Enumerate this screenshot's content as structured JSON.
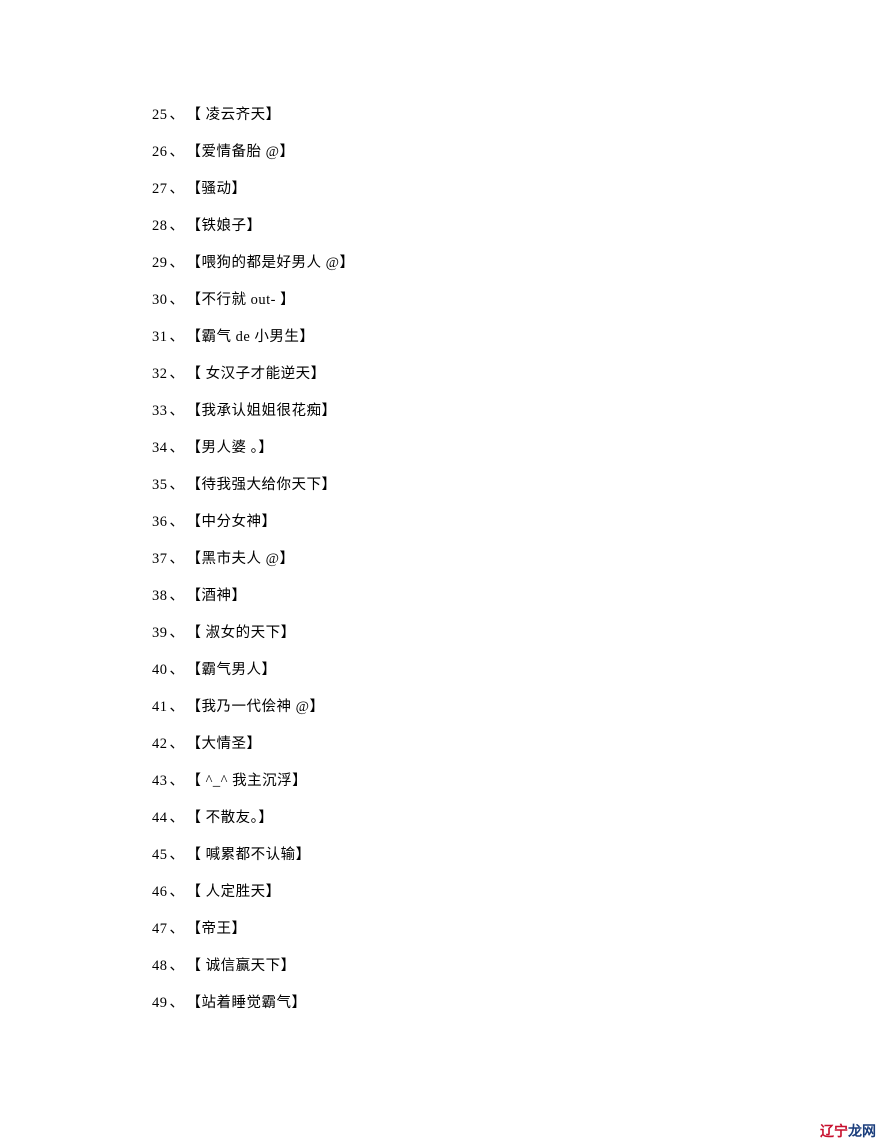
{
  "items": [
    {
      "num": "25",
      "text": "【  凌云齐天】"
    },
    {
      "num": "26",
      "text": "【爱情备胎  @】"
    },
    {
      "num": "27",
      "text": "【骚动】"
    },
    {
      "num": "28",
      "text": "【铁娘子】"
    },
    {
      "num": "29",
      "text": "【喂狗的都是好男人  @】"
    },
    {
      "num": "30",
      "text": "【不行就  out- 】"
    },
    {
      "num": "31",
      "text": "【霸气  de 小男生】"
    },
    {
      "num": "32",
      "text": "【   女汉子才能逆天】"
    },
    {
      "num": "33",
      "text": "【我承认姐姐很花痴】"
    },
    {
      "num": "34",
      "text": "【男人婆    。】"
    },
    {
      "num": "35",
      "text": "【待我强大给你天下】"
    },
    {
      "num": "36",
      "text": "【中分女神】"
    },
    {
      "num": "37",
      "text": "【黑市夫人  @】"
    },
    {
      "num": "38",
      "text": "【酒神】"
    },
    {
      "num": "39",
      "text": "【   淑女的天下】"
    },
    {
      "num": "40",
      "text": "【霸气男人】"
    },
    {
      "num": "41",
      "text": "【我乃一代侩神  @】"
    },
    {
      "num": "42",
      "text": "【大情圣】"
    },
    {
      "num": "43",
      "text": "【 ^_^  我主沉浮】"
    },
    {
      "num": "44",
      "text": "【   不散友。】"
    },
    {
      "num": "45",
      "text": "【   喊累都不认输】"
    },
    {
      "num": "46",
      "text": "【   人定胜天】"
    },
    {
      "num": "47",
      "text": "【帝王】"
    },
    {
      "num": "48",
      "text": "【   诚信赢天下】"
    },
    {
      "num": "49",
      "text": "【站着睡觉霸气】"
    }
  ],
  "separator": "、",
  "watermark": {
    "red": "辽宁",
    "blue": "龙网",
    "gray": ""
  }
}
